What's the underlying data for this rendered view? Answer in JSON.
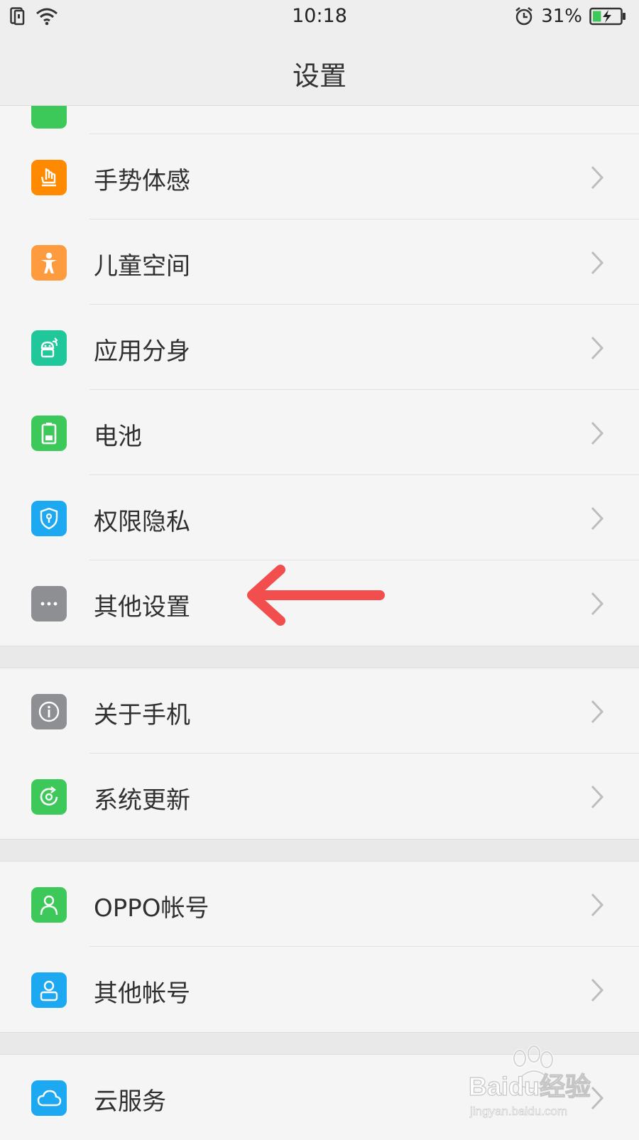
{
  "status_bar": {
    "time": "10:18",
    "battery_percent": "31%",
    "battery_level": 0.31,
    "icons": [
      "sim-icon",
      "wifi-icon",
      "alarm-icon",
      "battery-charging-icon"
    ]
  },
  "header": {
    "title": "设置"
  },
  "settings": {
    "items": [
      {
        "label": "手势体感",
        "icon": "gesture-hand-icon",
        "color": "#ff8a00"
      },
      {
        "label": "儿童空间",
        "icon": "child-icon",
        "color": "#ff9b3f"
      },
      {
        "label": "应用分身",
        "icon": "app-clone-icon",
        "color": "#1fc79a"
      },
      {
        "label": "电池",
        "icon": "battery-icon",
        "color": "#3dc85a"
      },
      {
        "label": "权限隐私",
        "icon": "privacy-shield-icon",
        "color": "#1da8f2"
      },
      {
        "label": "其他设置",
        "icon": "more-dots-icon",
        "color": "#8e8f93"
      },
      {
        "label": "关于手机",
        "icon": "info-icon",
        "color": "#8e8f93"
      },
      {
        "label": "系统更新",
        "icon": "update-icon",
        "color": "#3dc85a"
      },
      {
        "label": "OPPO帐号",
        "icon": "person-icon",
        "color": "#3dc85a"
      },
      {
        "label": "其他帐号",
        "icon": "account-icon",
        "color": "#1da8f2"
      },
      {
        "label": "云服务",
        "icon": "cloud-icon",
        "color": "#1da8f2"
      }
    ]
  },
  "annotation": {
    "points_to": "其他设置",
    "color": "#f24e4e"
  },
  "watermark": {
    "brand": "Baidu经验",
    "url": "jingyan.baidu.com"
  }
}
